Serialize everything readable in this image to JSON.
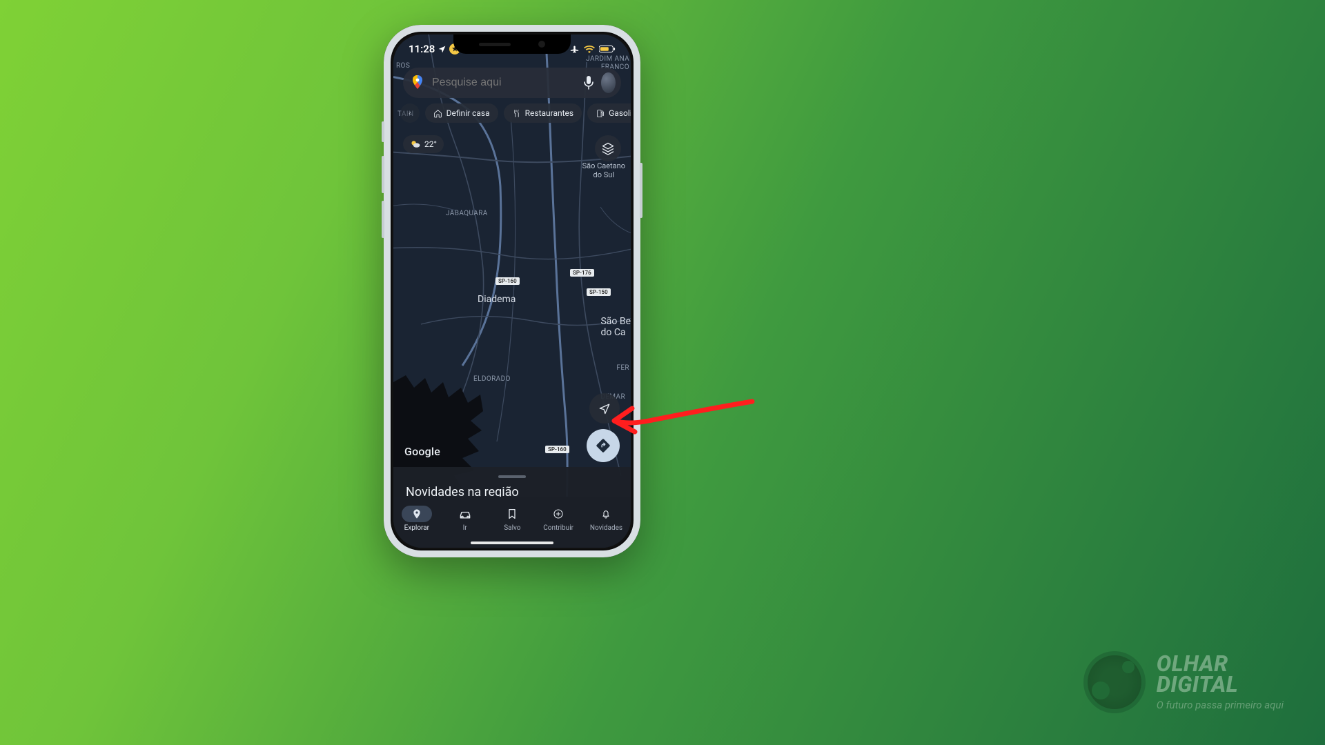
{
  "status": {
    "time": "11:28"
  },
  "search": {
    "placeholder": "Pesquise aqui"
  },
  "chips": [
    {
      "icon": "home",
      "label": "Definir casa"
    },
    {
      "icon": "fork",
      "label": "Restaurantes"
    },
    {
      "icon": "gas",
      "label": "Gasolina"
    }
  ],
  "weather": {
    "temp": "22°"
  },
  "map": {
    "labels": {
      "jabaquara": "JABAQUARA",
      "eldorado": "ELDORADO",
      "tain": "TAIN",
      "ros": "ROS",
      "jardim": "JARDIM ANA",
      "franco": "FRANCO",
      "demar": "DEMAR",
      "fer": "FER"
    },
    "cities": {
      "diadema": "Diadema",
      "scs1": "São Caetano",
      "scs2": "do Sul",
      "sbc1": "São Be",
      "sbc2": "do Ca"
    },
    "roads": {
      "sp160": "SP-160",
      "sp176": "SP-176",
      "sp150": "SP-150",
      "sp160b": "SP-160"
    },
    "brand": "Google"
  },
  "sheet": {
    "title": "Novidades na região"
  },
  "nav": [
    {
      "id": "explorar",
      "label": "Explorar"
    },
    {
      "id": "ir",
      "label": "Ir"
    },
    {
      "id": "salvo",
      "label": "Salvo"
    },
    {
      "id": "contribuir",
      "label": "Contribuir"
    },
    {
      "id": "novidades",
      "label": "Novidades"
    }
  ],
  "watermark": {
    "line1": "OLHAR",
    "line2": "DIGITAL",
    "tag": "O futuro passa primeiro aqui"
  }
}
